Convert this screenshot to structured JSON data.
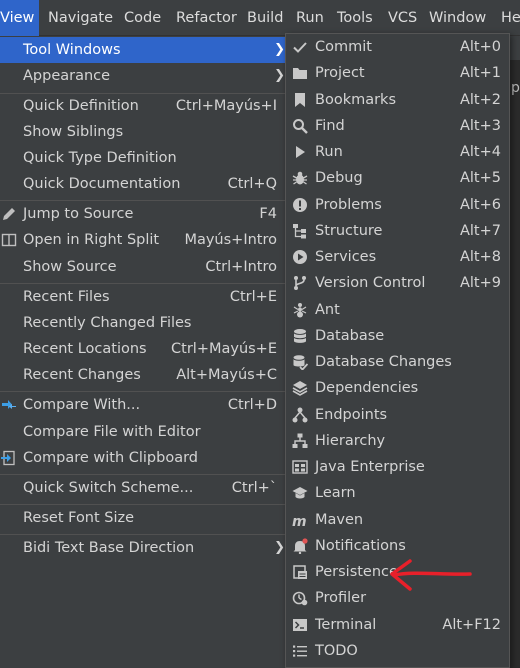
{
  "menubar": {
    "items": [
      "View",
      "Navigate",
      "Code",
      "Refactor",
      "Build",
      "Run",
      "Tools",
      "VCS",
      "Window",
      "He"
    ]
  },
  "view_menu": {
    "items": [
      {
        "label": "Tool Windows",
        "shortcut": "",
        "submenu": true,
        "active": true
      },
      {
        "label": "Appearance",
        "shortcut": "",
        "submenu": true
      },
      {
        "label": "Quick Definition",
        "shortcut": "Ctrl+Mayús+I"
      },
      {
        "label": "Show Siblings",
        "shortcut": ""
      },
      {
        "label": "Quick Type Definition",
        "shortcut": ""
      },
      {
        "label": "Quick Documentation",
        "shortcut": "Ctrl+Q"
      },
      {
        "label": "Jump to Source",
        "shortcut": "F4",
        "icon": "pencil-icon"
      },
      {
        "label": "Open in Right Split",
        "shortcut": "Mayús+Intro",
        "icon": "split-icon"
      },
      {
        "label": "Show Source",
        "shortcut": "Ctrl+Intro"
      },
      {
        "label": "Recent Files",
        "shortcut": "Ctrl+E"
      },
      {
        "label": "Recently Changed Files",
        "shortcut": ""
      },
      {
        "label": "Recent Locations",
        "shortcut": "Ctrl+Mayús+E"
      },
      {
        "label": "Recent Changes",
        "shortcut": "Alt+Mayús+C"
      },
      {
        "label": "Compare With...",
        "shortcut": "Ctrl+D",
        "icon": "compare-icon"
      },
      {
        "label": "Compare File with Editor",
        "shortcut": ""
      },
      {
        "label": "Compare with Clipboard",
        "shortcut": "",
        "icon": "clipboard-compare-icon"
      },
      {
        "label": "Quick Switch Scheme...",
        "shortcut": "Ctrl+`"
      },
      {
        "label": "Reset Font Size",
        "shortcut": ""
      },
      {
        "label": "Bidi Text Base Direction",
        "shortcut": "",
        "submenu": true
      }
    ]
  },
  "tool_windows_submenu": {
    "items": [
      {
        "label": "Commit",
        "shortcut": "Alt+0",
        "icon": "commit-icon"
      },
      {
        "label": "Project",
        "shortcut": "Alt+1",
        "icon": "folder-icon"
      },
      {
        "label": "Bookmarks",
        "shortcut": "Alt+2",
        "icon": "bookmark-icon"
      },
      {
        "label": "Find",
        "shortcut": "Alt+3",
        "icon": "search-icon"
      },
      {
        "label": "Run",
        "shortcut": "Alt+4",
        "icon": "play-icon"
      },
      {
        "label": "Debug",
        "shortcut": "Alt+5",
        "icon": "bug-icon"
      },
      {
        "label": "Problems",
        "shortcut": "Alt+6",
        "icon": "warning-icon"
      },
      {
        "label": "Structure",
        "shortcut": "Alt+7",
        "icon": "structure-icon"
      },
      {
        "label": "Services",
        "shortcut": "Alt+8",
        "icon": "services-icon"
      },
      {
        "label": "Version Control",
        "shortcut": "Alt+9",
        "icon": "branch-icon"
      },
      {
        "label": "Ant",
        "shortcut": "",
        "icon": "ant-icon"
      },
      {
        "label": "Database",
        "shortcut": "",
        "icon": "database-icon"
      },
      {
        "label": "Database Changes",
        "shortcut": "",
        "icon": "database-changes-icon"
      },
      {
        "label": "Dependencies",
        "shortcut": "",
        "icon": "dependencies-icon"
      },
      {
        "label": "Endpoints",
        "shortcut": "",
        "icon": "endpoints-icon"
      },
      {
        "label": "Hierarchy",
        "shortcut": "",
        "icon": "hierarchy-icon"
      },
      {
        "label": "Java Enterprise",
        "shortcut": "",
        "icon": "java-enterprise-icon"
      },
      {
        "label": "Learn",
        "shortcut": "",
        "icon": "learn-icon"
      },
      {
        "label": "Maven",
        "shortcut": "",
        "icon": "maven-icon"
      },
      {
        "label": "Notifications",
        "shortcut": "",
        "icon": "bell-icon"
      },
      {
        "label": "Persistence",
        "shortcut": "",
        "icon": "persistence-icon"
      },
      {
        "label": "Profiler",
        "shortcut": "",
        "icon": "profiler-icon"
      },
      {
        "label": "Terminal",
        "shortcut": "Alt+F12",
        "icon": "terminal-icon"
      },
      {
        "label": "TODO",
        "shortcut": "",
        "icon": "todo-icon"
      }
    ]
  },
  "background": {
    "peek_char": "p"
  },
  "colors": {
    "menu_bg": "#3c3f41",
    "highlight": "#2f65ca",
    "annotation": "#e8202a"
  }
}
